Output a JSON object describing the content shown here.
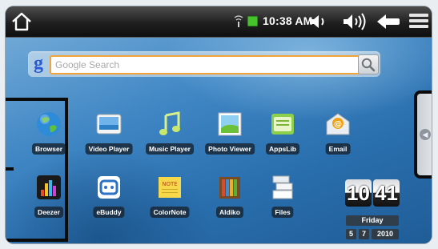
{
  "statusbar": {
    "time": "10:38 AM",
    "icons": [
      "home-icon",
      "signal-icon",
      "battery-icon",
      "volume-down-icon",
      "volume-up-icon",
      "back-arrow-icon",
      "menu-icon"
    ]
  },
  "search": {
    "placeholder": "Google Search",
    "value": "",
    "logo_letter": "g",
    "accent": "#f2a33a"
  },
  "apps": [
    {
      "label": "Browser",
      "icon": "globe-icon"
    },
    {
      "label": "Video Player",
      "icon": "video-icon"
    },
    {
      "label": "Music Player",
      "icon": "music-icon"
    },
    {
      "label": "Photo Viewer",
      "icon": "photo-icon"
    },
    {
      "label": "AppsLib",
      "icon": "appslib-icon"
    },
    {
      "label": "Email",
      "icon": "email-icon"
    },
    {
      "label": "Deezer",
      "icon": "deezer-icon"
    },
    {
      "label": "eBuddy",
      "icon": "ebuddy-icon"
    },
    {
      "label": "ColorNote",
      "icon": "note-icon"
    },
    {
      "label": "Aldiko",
      "icon": "books-icon"
    },
    {
      "label": "Files",
      "icon": "files-icon"
    }
  ],
  "clock_widget": {
    "hour": "10",
    "minute": "41",
    "day": "Friday",
    "month": "5",
    "date": "7",
    "year": "2010"
  }
}
